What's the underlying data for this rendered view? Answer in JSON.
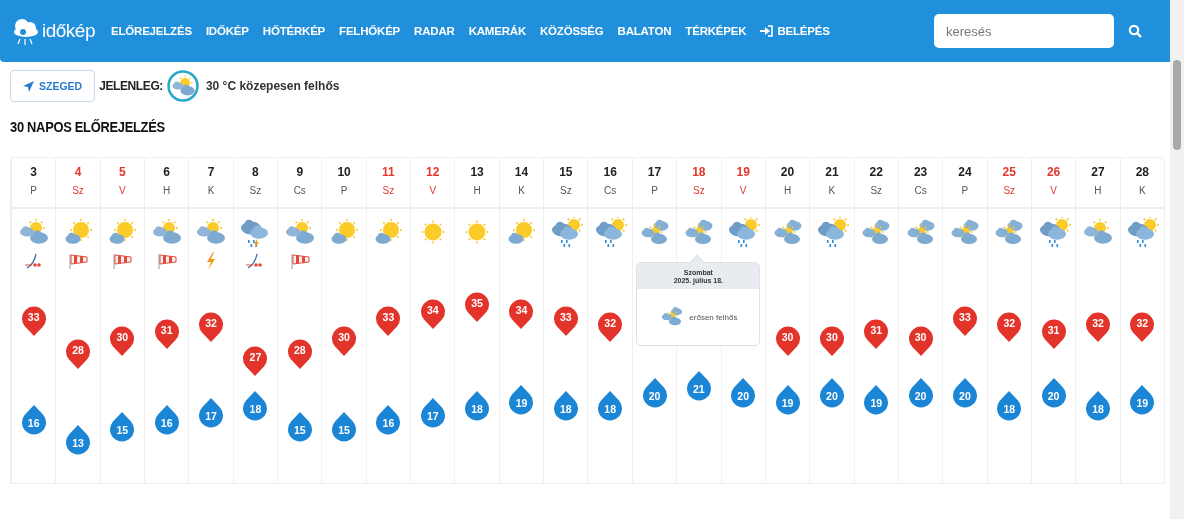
{
  "header": {
    "logo": "időkép",
    "nav": [
      {
        "label": "ELŐREJELZÉS",
        "kind": "link"
      },
      {
        "label": "IDŐKÉP",
        "kind": "link"
      },
      {
        "label": "HŐTÉRKÉP",
        "kind": "link"
      },
      {
        "label": "FELHŐKÉP",
        "kind": "link"
      },
      {
        "label": "RADAR",
        "kind": "link"
      },
      {
        "label": "KAMERÁK",
        "kind": "link"
      },
      {
        "label": "KÖZÖSSÉG",
        "kind": "link"
      },
      {
        "label": "BALATON",
        "kind": "link"
      },
      {
        "label": "TÉRKÉPEK",
        "kind": "link"
      },
      {
        "label": "BELÉPÉS",
        "kind": "login"
      }
    ],
    "search": {
      "placeholder": "keresés"
    }
  },
  "location": {
    "button": "SZEGED",
    "label": "JELENLEG:",
    "current": "30 °C közepesen felhős"
  },
  "title": "30 NAPOS ELŐREJELZÉS",
  "days": [
    {
      "date": "3",
      "weekday": "P",
      "weekend": false,
      "sky_icon": {
        "kind": "partly"
      },
      "extra_icon": {
        "kind": "gust"
      },
      "max": "33",
      "min": "16"
    },
    {
      "date": "4",
      "weekday": "Sz",
      "weekend": true,
      "sky_icon": {
        "kind": "suncloud"
      },
      "extra_icon": {
        "kind": "wind"
      },
      "max": "28",
      "min": "13"
    },
    {
      "date": "5",
      "weekday": "V",
      "weekend": true,
      "sky_icon": {
        "kind": "suncloud"
      },
      "extra_icon": {
        "kind": "wind"
      },
      "max": "30",
      "min": "15"
    },
    {
      "date": "6",
      "weekday": "H",
      "weekend": false,
      "sky_icon": {
        "kind": "partly"
      },
      "extra_icon": {
        "kind": "wind"
      },
      "max": "31",
      "min": "16"
    },
    {
      "date": "7",
      "weekday": "K",
      "weekend": false,
      "sky_icon": {
        "kind": "partly"
      },
      "extra_icon": {
        "kind": "thunder"
      },
      "max": "32",
      "min": "17"
    },
    {
      "date": "8",
      "weekday": "Sz",
      "weekend": false,
      "sky_icon": {
        "kind": "storm"
      },
      "extra_icon": {
        "kind": "gust"
      },
      "max": "27",
      "min": "18"
    },
    {
      "date": "9",
      "weekday": "Cs",
      "weekend": false,
      "sky_icon": {
        "kind": "partly"
      },
      "extra_icon": {
        "kind": "wind"
      },
      "max": "28",
      "min": "15"
    },
    {
      "date": "10",
      "weekday": "P",
      "weekend": false,
      "sky_icon": {
        "kind": "suncloud"
      },
      "max": "30",
      "min": "15"
    },
    {
      "date": "11",
      "weekday": "Sz",
      "weekend": true,
      "sky_icon": {
        "kind": "suncloud"
      },
      "max": "33",
      "min": "16"
    },
    {
      "date": "12",
      "weekday": "V",
      "weekend": true,
      "sky_icon": {
        "kind": "sun"
      },
      "max": "34",
      "min": "17"
    },
    {
      "date": "13",
      "weekday": "H",
      "weekend": false,
      "sky_icon": {
        "kind": "sun"
      },
      "max": "35",
      "min": "18"
    },
    {
      "date": "14",
      "weekday": "K",
      "weekend": false,
      "sky_icon": {
        "kind": "suncloud"
      },
      "max": "34",
      "min": "19"
    },
    {
      "date": "15",
      "weekday": "Sz",
      "weekend": false,
      "sky_icon": {
        "kind": "rainsun"
      },
      "max": "33",
      "min": "18"
    },
    {
      "date": "16",
      "weekday": "Cs",
      "weekend": false,
      "sky_icon": {
        "kind": "rainsun"
      },
      "max": "32",
      "min": "18"
    },
    {
      "date": "17",
      "weekday": "P",
      "weekend": false,
      "sky_icon": {
        "kind": "cloudy"
      },
      "min": "20"
    },
    {
      "date": "18",
      "weekday": "Sz",
      "weekend": true,
      "sky_icon": {
        "kind": "cloudy"
      },
      "min": "21",
      "tooltip": {
        "title": "Szombat",
        "date": "2025. július 18.",
        "icon": {
          "kind": "cloudy"
        },
        "text": "erősen felhős"
      }
    },
    {
      "date": "19",
      "weekday": "V",
      "weekend": true,
      "sky_icon": {
        "kind": "rainsun"
      },
      "min": "20"
    },
    {
      "date": "20",
      "weekday": "H",
      "weekend": false,
      "sky_icon": {
        "kind": "cloudy"
      },
      "max": "30",
      "min": "19"
    },
    {
      "date": "21",
      "weekday": "K",
      "weekend": false,
      "sky_icon": {
        "kind": "rainsun"
      },
      "max": "30",
      "min": "20"
    },
    {
      "date": "22",
      "weekday": "Sz",
      "weekend": false,
      "sky_icon": {
        "kind": "cloudy"
      },
      "max": "31",
      "min": "19"
    },
    {
      "date": "23",
      "weekday": "Cs",
      "weekend": false,
      "sky_icon": {
        "kind": "cloudy"
      },
      "max": "30",
      "min": "20"
    },
    {
      "date": "24",
      "weekday": "P",
      "weekend": false,
      "sky_icon": {
        "kind": "cloudy"
      },
      "max": "33",
      "min": "20"
    },
    {
      "date": "25",
      "weekday": "Sz",
      "weekend": true,
      "sky_icon": {
        "kind": "cloudy"
      },
      "max": "32",
      "min": "18"
    },
    {
      "date": "26",
      "weekday": "V",
      "weekend": true,
      "sky_icon": {
        "kind": "rainsun"
      },
      "max": "31",
      "min": "20"
    },
    {
      "date": "27",
      "weekday": "H",
      "weekend": false,
      "sky_icon": {
        "kind": "partly"
      },
      "max": "32",
      "min": "18"
    },
    {
      "date": "28",
      "weekday": "K",
      "weekend": false,
      "sky_icon": {
        "kind": "rainsun"
      },
      "max": "32",
      "min": "19"
    }
  ]
}
